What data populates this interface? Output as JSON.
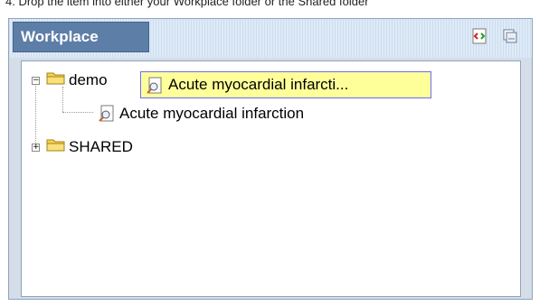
{
  "instruction": "4. Drop the item into either your Workplace folder or the Shared folder",
  "panel": {
    "tab_label": "Workplace",
    "icons": [
      "refresh-icon",
      "collapse-icon"
    ]
  },
  "tree": {
    "nodes": [
      {
        "label": "demo",
        "type": "folder",
        "expanded": true
      },
      {
        "label": "Acute myocardial infarction",
        "type": "document"
      },
      {
        "label": "SHARED",
        "type": "folder",
        "expanded": false
      }
    ]
  },
  "drag_ghost": {
    "label": "Acute myocardial infarcti..."
  }
}
